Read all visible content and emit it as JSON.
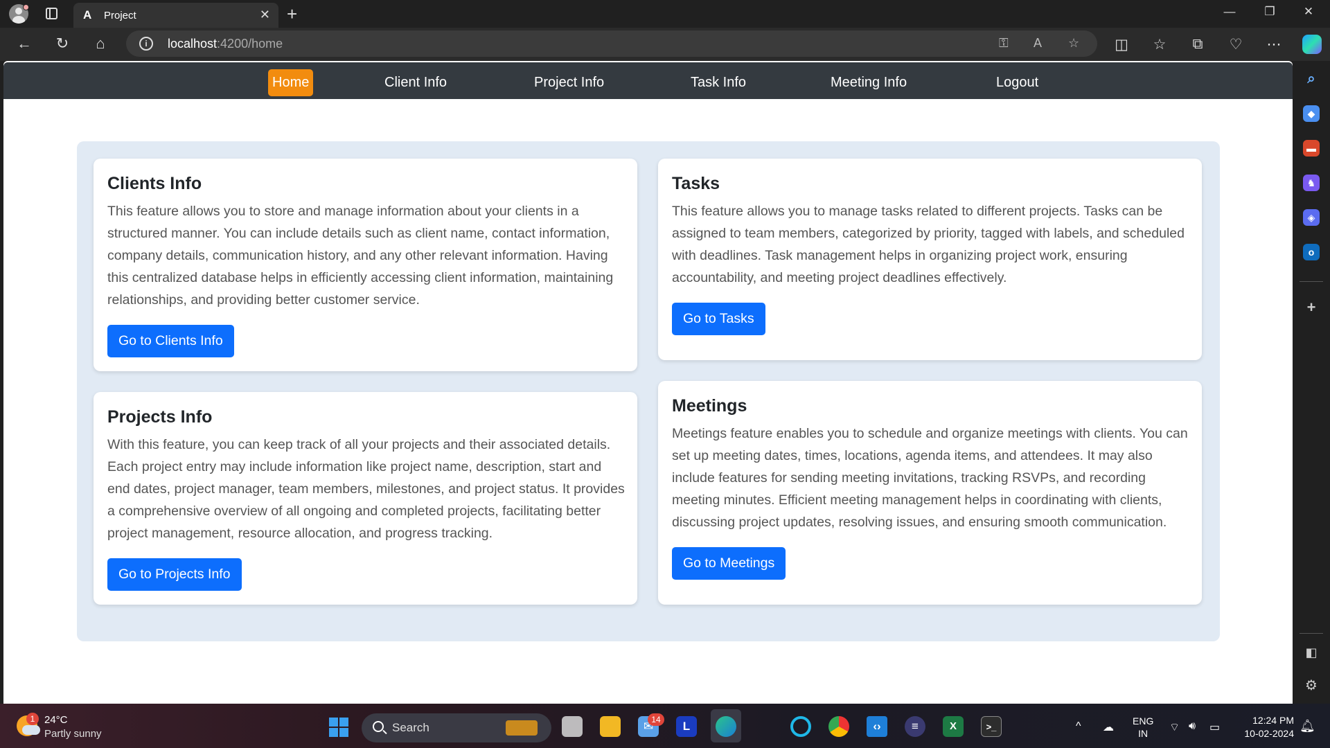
{
  "browser": {
    "tab_favicon": "A",
    "tab_title": "Project",
    "tab_close": "✕",
    "new_tab": "+",
    "url_host": "localhost",
    "url_path": ":4200/home",
    "window_controls": [
      "—",
      "❐",
      "✕"
    ]
  },
  "nav": {
    "items": [
      "Home",
      "Client Info",
      "Project Info",
      "Task Info",
      "Meeting Info",
      "Logout"
    ],
    "active_color": "#f28c0f",
    "bar_color": "#343a40"
  },
  "cards": {
    "clients": {
      "title": "Clients Info",
      "text": "This feature allows you to store and manage information about your clients in a structured manner. You can include details such as client name, contact information, company details, communication history, and any other relevant information. Having this centralized database helps in efficiently accessing client information, maintaining relationships, and providing better customer service.",
      "button": "Go to Clients Info"
    },
    "tasks": {
      "title": "Tasks",
      "text": "This feature allows you to manage tasks related to different projects. Tasks can be assigned to team members, categorized by priority, tagged with labels, and scheduled with deadlines. Task management helps in organizing project work, ensuring accountability, and meeting project deadlines effectively.",
      "button": "Go to Tasks"
    },
    "projects": {
      "title": "Projects Info",
      "text": "With this feature, you can keep track of all your projects and their associated details. Each project entry may include information like project name, description, start and end dates, project manager, team members, milestones, and project status. It provides a comprehensive overview of all ongoing and completed projects, facilitating better project management, resource allocation, and progress tracking.",
      "button": "Go to Projects Info"
    },
    "meetings": {
      "title": "Meetings",
      "text": "Meetings feature enables you to schedule and organize meetings with clients. You can set up meeting dates, times, locations, agenda items, and attendees. It may also include features for sending meeting invitations, tracking RSVPs, and recording meeting minutes. Efficient meeting management helps in coordinating with clients, discussing project updates, resolving issues, and ensuring smooth communication.",
      "button": "Go to Meetings"
    },
    "button_color": "#0d6efd"
  },
  "taskbar": {
    "weather_temp": "24°C",
    "weather_desc": "Partly sunny",
    "weather_badge": "1",
    "search_placeholder": "Search",
    "mail_badge": "14",
    "app_l": "L",
    "app_excel": "X",
    "lang_top": "ENG",
    "lang_bottom": "IN",
    "time": "12:24 PM",
    "date": "10-02-2024"
  }
}
